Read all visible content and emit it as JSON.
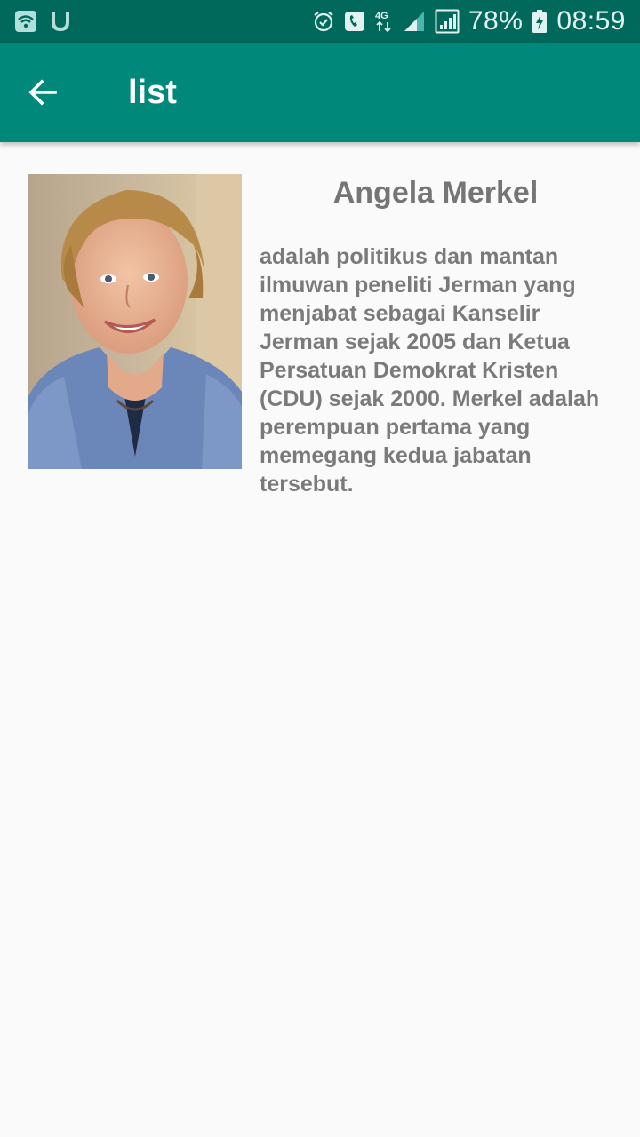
{
  "status_bar": {
    "battery": "78%",
    "time": "08:59",
    "network": "4G",
    "icons": [
      "wifi-icon",
      "u-app-icon",
      "alarm-icon",
      "call-icon",
      "signal-icon",
      "battery-charging-icon"
    ]
  },
  "app_bar": {
    "title": "list",
    "back_icon": "arrow-back-icon",
    "color": "#00897b"
  },
  "profile": {
    "name": "Angela Merkel",
    "description": "adalah politikus dan mantan ilmuwan peneliti Jerman yang menjabat sebagai Kanselir Jerman sejak 2005 dan Ketua Persatuan Demokrat Kristen (CDU) sejak 2000. Merkel adalah perempuan pertama yang memegang kedua jabatan tersebut."
  }
}
